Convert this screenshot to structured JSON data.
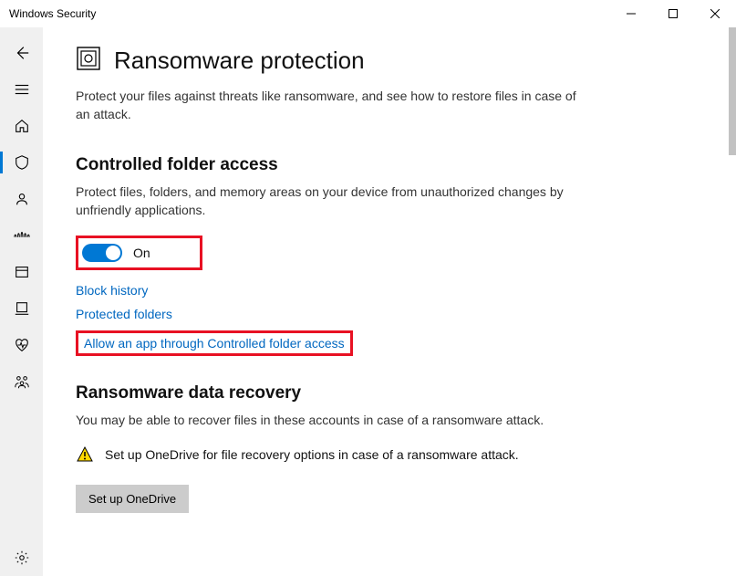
{
  "window": {
    "title": "Windows Security"
  },
  "page": {
    "title": "Ransomware protection",
    "description": "Protect your files against threats like ransomware, and see how to restore files in case of an attack."
  },
  "controlled_folder": {
    "title": "Controlled folder access",
    "description": "Protect files, folders, and memory areas on your device from unauthorized changes by unfriendly applications.",
    "toggle_on": true,
    "toggle_label": "On",
    "links": {
      "block_history": "Block history",
      "protected_folders": "Protected folders",
      "allow_app": "Allow an app through Controlled folder access"
    }
  },
  "recovery": {
    "title": "Ransomware data recovery",
    "description": "You may be able to recover files in these accounts in case of a ransomware attack.",
    "warning_text": "Set up OneDrive for file recovery options in case of a ransomware attack.",
    "button_label": "Set up OneDrive"
  },
  "colors": {
    "accent": "#0078d4",
    "link": "#0067c0",
    "highlight": "#e81123"
  }
}
